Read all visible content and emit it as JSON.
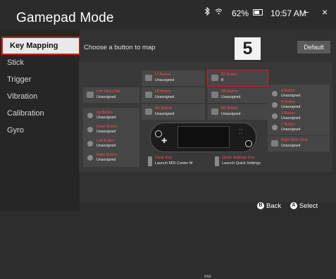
{
  "app": {
    "title": "Gamepad Mode"
  },
  "status": {
    "battery": "62%",
    "time": "10:57 AM",
    "minimize": "−",
    "close": "×"
  },
  "sidebar": {
    "items": [
      {
        "label": "Key Mapping"
      },
      {
        "label": "Stick"
      },
      {
        "label": "Trigger"
      },
      {
        "label": "Vibration"
      },
      {
        "label": "Calibration"
      },
      {
        "label": "Gyro"
      }
    ]
  },
  "main": {
    "hint": "Choose a button to map",
    "default_label": "Default",
    "step": "5"
  },
  "mapping": {
    "unassigned": "Unassigned",
    "lt": {
      "name": "LT Button",
      "value": "Unassigned"
    },
    "rt": {
      "name": "RT Button",
      "value": "B"
    },
    "lb": {
      "name": "LB Button",
      "value": "Unassigned"
    },
    "rb": {
      "name": "RB Button",
      "value": "Unassigned"
    },
    "m1": {
      "name": "M1 Button",
      "value": "Unassigned"
    },
    "m2": {
      "name": "M2 Button",
      "value": "Unassigned"
    },
    "lsc": {
      "name": "Left Stick Click",
      "value": "Unassigned"
    },
    "rsc": {
      "name": "Right Stick Click",
      "value": "Unassigned"
    },
    "left": [
      {
        "name": "Up Button",
        "value": "Unassigned"
      },
      {
        "name": "Down Button",
        "value": "Unassigned"
      },
      {
        "name": "Left Button",
        "value": "Unassigned"
      },
      {
        "name": "Right Button",
        "value": "Unassigned"
      }
    ],
    "right": [
      {
        "name": "A Button",
        "value": "Unassigned"
      },
      {
        "name": "B Button",
        "value": "Unassigned"
      },
      {
        "name": "X Button",
        "value": "Unassigned"
      },
      {
        "name": "Y Button",
        "value": "Unassigned"
      }
    ],
    "clear": {
      "name": "Clear Key",
      "value": "Launch MSI Center M"
    },
    "qs": {
      "name": "Quick Settings Key",
      "value": "Launch Quick Settings"
    },
    "brand": "msi"
  },
  "footer": {
    "back": "Back",
    "select": "Select",
    "back_key": "B",
    "select_key": "A"
  }
}
